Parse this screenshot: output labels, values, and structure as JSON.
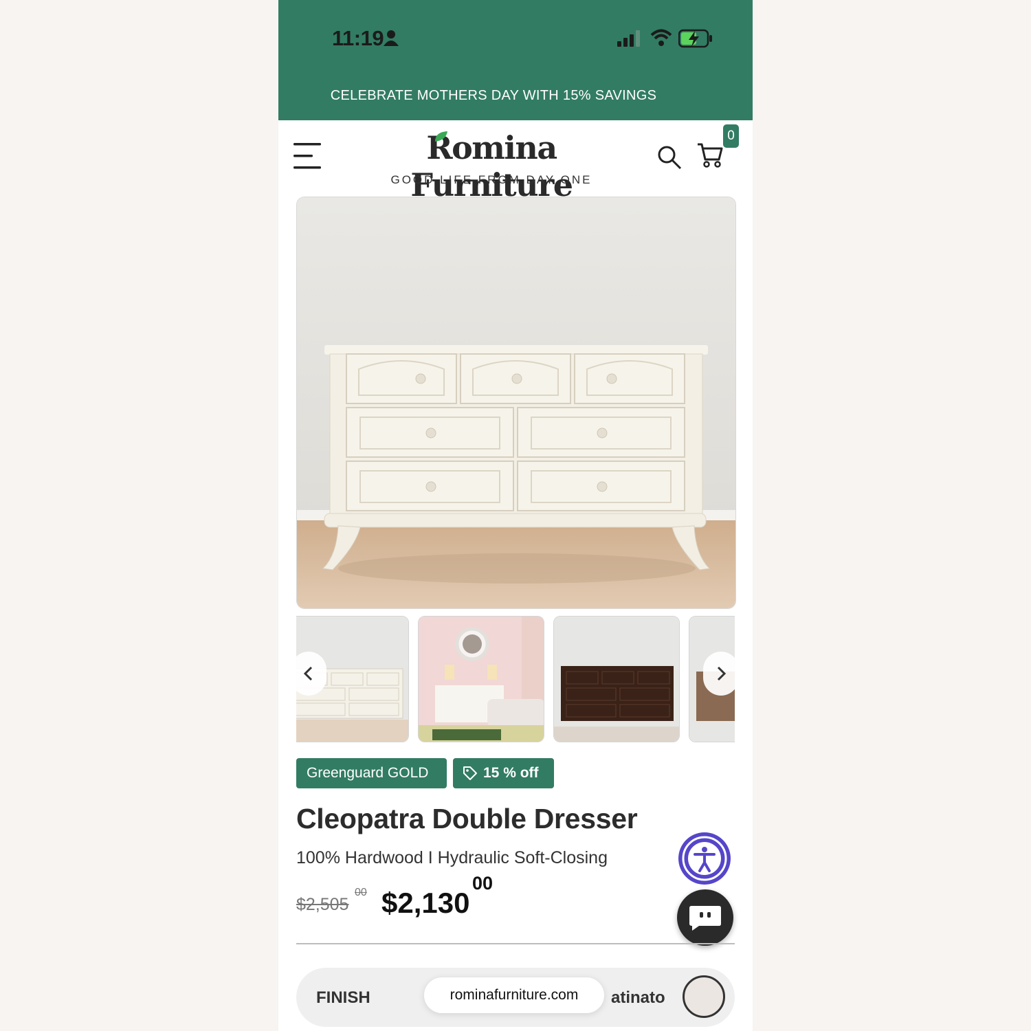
{
  "status_bar": {
    "time": "11:19"
  },
  "promo": {
    "text": "CELEBRATE MOTHERS DAY WITH 15% SAVINGS"
  },
  "header": {
    "logo": "Romina Furniture",
    "tagline": "GOOD LIFE FROM DAY ONE",
    "cart_count": "0"
  },
  "product": {
    "badges": {
      "certification": "Greenguard GOLD",
      "discount": "15 % off"
    },
    "title": "Cleopatra Double Dresser",
    "subtitle": "100% Hardwood I Hydraulic Soft-Closing",
    "old_price": "$2,505",
    "old_price_cents": "00",
    "price": "$2,130",
    "price_cents": "00"
  },
  "finish": {
    "label": "FINISH",
    "value": "atinato"
  },
  "browser": {
    "url": "rominafurniture.com"
  },
  "colors": {
    "brand_green": "#327c64",
    "accessibility_purple": "#5546c9"
  },
  "icons": [
    "person-icon",
    "signal-icon",
    "wifi-icon",
    "battery-icon",
    "menu-icon",
    "search-icon",
    "cart-icon",
    "chevron-left-icon",
    "chevron-right-icon",
    "tag-icon",
    "accessibility-icon",
    "chat-icon"
  ]
}
